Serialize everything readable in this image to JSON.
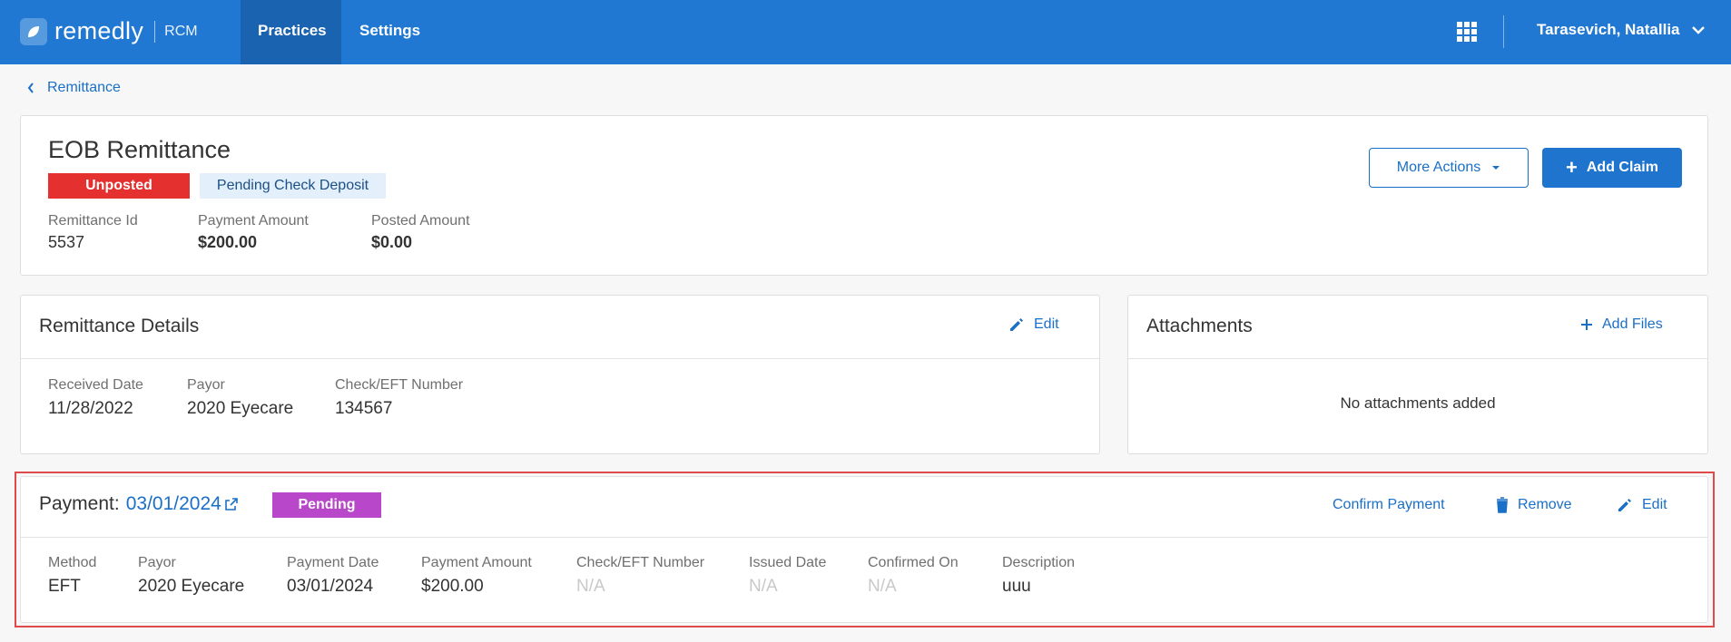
{
  "app": {
    "name": "remedly",
    "product": "RCM"
  },
  "nav": {
    "practices": "Practices",
    "settings": "Settings"
  },
  "user": {
    "name": "Tarasevich, Natallia"
  },
  "breadcrumb": {
    "label": "Remittance"
  },
  "header": {
    "title": "EOB Remittance",
    "status_badge": "Unposted",
    "deposit_badge": "Pending Check Deposit",
    "remittance_id_label": "Remittance Id",
    "remittance_id": "5537",
    "payment_amount_label": "Payment Amount",
    "payment_amount": "$200.00",
    "posted_amount_label": "Posted Amount",
    "posted_amount": "$0.00",
    "more_actions": "More Actions",
    "add_claim": "Add Claim"
  },
  "remittance_details": {
    "title": "Remittance Details",
    "edit": "Edit",
    "fields": [
      {
        "label": "Received Date",
        "value": "11/28/2022"
      },
      {
        "label": "Payor",
        "value": "2020 Eyecare"
      },
      {
        "label": "Check/EFT Number",
        "value": "134567"
      }
    ]
  },
  "attachments": {
    "title": "Attachments",
    "add_files": "Add Files",
    "empty": "No attachments added"
  },
  "payment": {
    "title_prefix": "Payment:",
    "date": "03/01/2024",
    "status": "Pending",
    "confirm": "Confirm Payment",
    "remove": "Remove",
    "edit": "Edit",
    "fields": [
      {
        "label": "Method",
        "value": "EFT"
      },
      {
        "label": "Payor",
        "value": "2020 Eyecare"
      },
      {
        "label": "Payment Date",
        "value": "03/01/2024"
      },
      {
        "label": "Payment Amount",
        "value": "$200.00"
      },
      {
        "label": "Check/EFT Number",
        "value": "N/A"
      },
      {
        "label": "Issued Date",
        "value": "N/A"
      },
      {
        "label": "Confirmed On",
        "value": "N/A"
      },
      {
        "label": "Description",
        "value": "uuu"
      }
    ]
  },
  "colors": {
    "brand": "#2178d3",
    "unposted": "#e53030",
    "pending": "#b847c9",
    "link": "#1a6fc7"
  }
}
